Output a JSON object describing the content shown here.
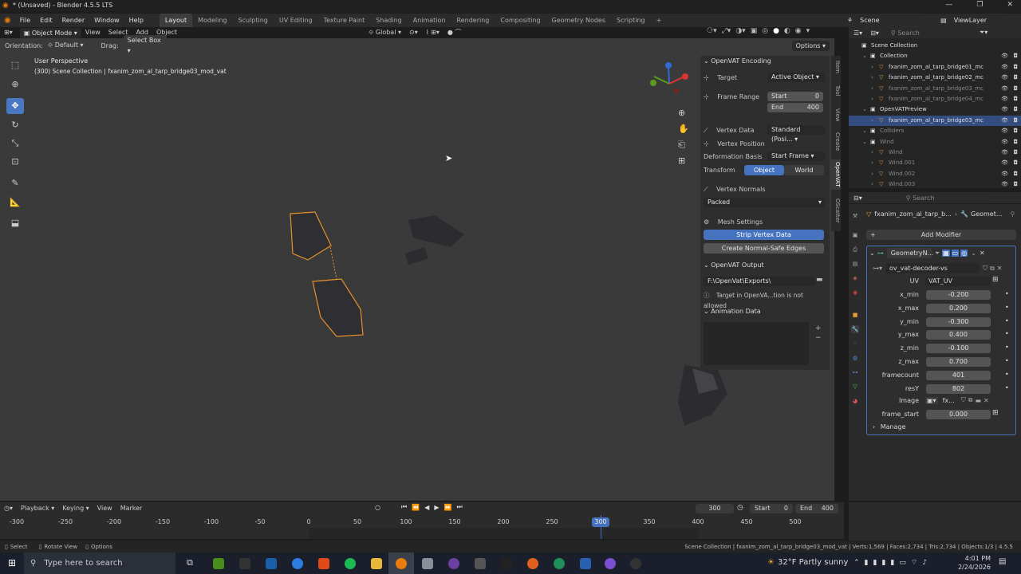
{
  "window": {
    "title": "* (Unsaved) - Blender 4.5.5 LTS"
  },
  "menu": [
    "File",
    "Edit",
    "Render",
    "Window",
    "Help"
  ],
  "workspaces": [
    "Layout",
    "Modeling",
    "Sculpting",
    "UV Editing",
    "Texture Paint",
    "Shading",
    "Animation",
    "Rendering",
    "Compositing",
    "Geometry Nodes",
    "Scripting"
  ],
  "active_workspace": "Layout",
  "scene": {
    "label": "Scene",
    "view_layer": "ViewLayer"
  },
  "viewport_header": {
    "mode": "Object Mode",
    "view": "View",
    "select": "Select",
    "add": "Add",
    "object": "Object",
    "transform_orientation": "Global",
    "orientation_label": "Orientation:",
    "orientation_value": "Default",
    "drag_label": "Drag:",
    "drag_value": "Select Box",
    "options": "Options"
  },
  "viewport": {
    "perspective": "User Perspective",
    "collection_info": "(300) Scene Collection | fxanim_zom_al_tarp_bridge03_mod_vat"
  },
  "npanel": {
    "encoding_title": "OpenVAT Encoding",
    "target_label": "Target",
    "target_value": "Active Object",
    "frame_range_label": "Frame Range",
    "start_label": "Start",
    "start_value": "0",
    "end_label": "End",
    "end_value": "400",
    "vertex_data_label": "Vertex Data",
    "vertex_data_value": "Standard (Posi...",
    "vertex_position": "Vertex Position",
    "deformation_basis_label": "Deformation Basis",
    "deformation_basis_value": "Start Frame",
    "transform_label": "Transform",
    "transform_object": "Object",
    "transform_world": "World",
    "vertex_normals": "Vertex Normals",
    "vertex_normals_value": "Packed",
    "mesh_settings": "Mesh Settings",
    "strip_vertex_data": "Strip Vertex Data",
    "create_normal_safe": "Create Normal-Safe Edges",
    "output_title": "OpenVAT Output",
    "output_path": "F:\\OpenVat\\Exports\\",
    "warning": "Target in OpenVA...tion is not allowed",
    "animation_data": "Animation Data"
  },
  "sidetabs": [
    "Item",
    "Tool",
    "View",
    "Create",
    "OpenVAT",
    "OScatter"
  ],
  "outliner": {
    "search_placeholder": "Search",
    "rows": [
      {
        "name": "Scene Collection",
        "indent": 0
      },
      {
        "name": "Collection",
        "indent": 1
      },
      {
        "name": "fxanim_zom_al_tarp_bridge01_mc",
        "indent": 2
      },
      {
        "name": "fxanim_zom_al_tarp_bridge02_mc",
        "indent": 2
      },
      {
        "name": "fxanim_zom_al_tarp_bridge03_mc",
        "indent": 2,
        "dim": true
      },
      {
        "name": "fxanim_zom_al_tarp_bridge04_mc",
        "indent": 2,
        "dim": true
      },
      {
        "name": "OpenVATPreview",
        "indent": 1
      },
      {
        "name": "fxanim_zom_al_tarp_bridge03_mc",
        "indent": 2,
        "selected": true
      },
      {
        "name": "Colliders",
        "indent": 1,
        "dim": true
      },
      {
        "name": "Wind",
        "indent": 1,
        "dim": true
      },
      {
        "name": "Wind",
        "indent": 2,
        "dim": true
      },
      {
        "name": "Wind.001",
        "indent": 2,
        "dim": true
      },
      {
        "name": "Wind.002",
        "indent": 2,
        "dim": true
      },
      {
        "name": "Wind.003",
        "indent": 2,
        "dim": true
      }
    ]
  },
  "properties": {
    "search_placeholder": "Search",
    "breadcrumb_object": "fxanim_zom_al_tarp_b...",
    "breadcrumb_modifier": "Geomet...",
    "add_modifier": "Add Modifier",
    "modifier_name": "GeometryN...",
    "node_group": "ov_vat-decoder-vs",
    "uv_label": "UV",
    "uv_value": "VAT_UV",
    "params": [
      {
        "label": "x_min",
        "value": "-0.200"
      },
      {
        "label": "x_max",
        "value": "0.200"
      },
      {
        "label": "y_min",
        "value": "-0.300"
      },
      {
        "label": "y_max",
        "value": "0.400"
      },
      {
        "label": "z_min",
        "value": "-0.100"
      },
      {
        "label": "z_max",
        "value": "0.700"
      },
      {
        "label": "framecount",
        "value": "401"
      },
      {
        "label": "resY",
        "value": "802"
      }
    ],
    "image_label": "Image",
    "image_value": "fx...",
    "frame_start_label": "frame_start",
    "frame_start_value": "0.000",
    "manage": "Manage"
  },
  "timeline": {
    "playback": "Playback",
    "keying": "Keying",
    "view": "View",
    "marker": "Marker",
    "current_frame": "300",
    "start_label": "Start",
    "start_value": "0",
    "end_label": "End",
    "end_value": "400",
    "ticks": [
      "-300",
      "-250",
      "-200",
      "-150",
      "-100",
      "-50",
      "0",
      "50",
      "100",
      "150",
      "200",
      "250",
      "300",
      "350",
      "400",
      "450",
      "500"
    ]
  },
  "statusbar": {
    "select": "Select",
    "rotate": "Rotate View",
    "options": "Options",
    "info": "Scene Collection | fxanim_zom_al_tarp_bridge03_mod_vat | Verts:1,569 | Faces:2,734 | Tris:2,734 | Objects:1/3 | 4.5.5"
  },
  "taskbar": {
    "search_placeholder": "Type here to search",
    "weather": "32°F  Partly sunny",
    "time": "4:01 PM",
    "date": "2/24/2026"
  },
  "colors": {
    "accent": "#4673c0",
    "selection_outline": "#e8902a",
    "viewport_bg": "#3a3a3a"
  }
}
